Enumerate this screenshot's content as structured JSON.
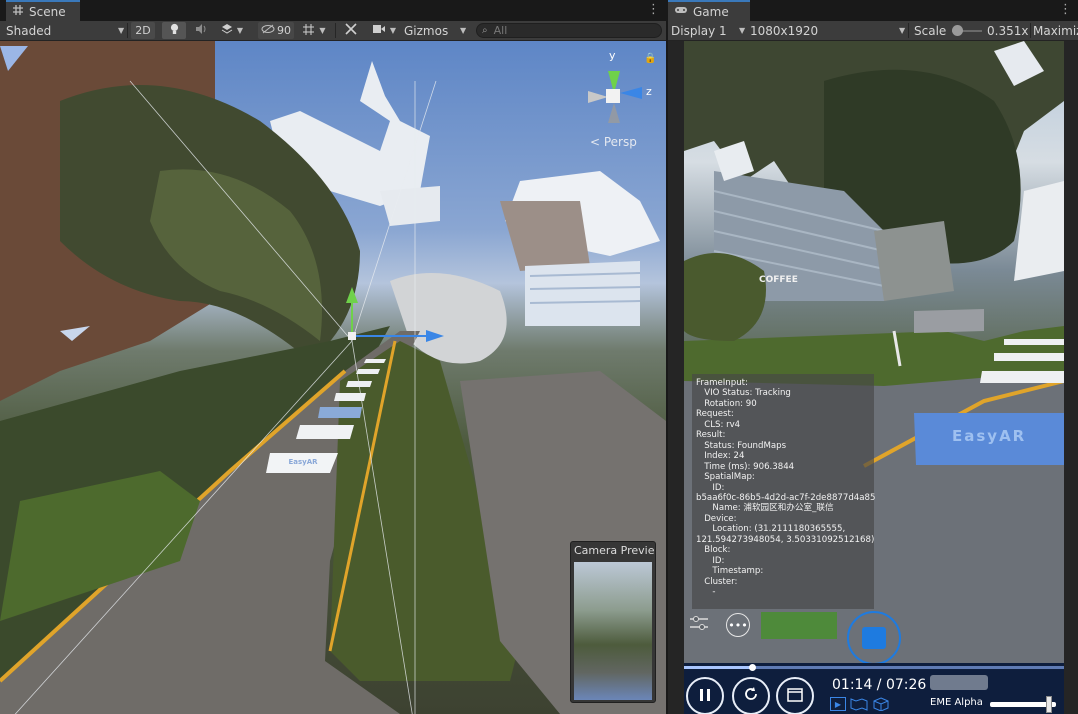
{
  "scene_tab": {
    "title": "Scene",
    "icon": "grid-icon"
  },
  "scene_toolbar": {
    "shading_mode": "Shaded",
    "mode_2d": "2D",
    "hidden_count": "90",
    "gizmos": "Gizmos",
    "search_placeholder": "All"
  },
  "scene_view": {
    "axis_y": "y",
    "axis_z": "z",
    "projection": "< Persp",
    "camera_preview_title": "Camera Preview",
    "crosswalk_text": "EasyAR"
  },
  "game_tab": {
    "title": "Game",
    "icon": "gamepad-icon"
  },
  "game_toolbar": {
    "display": "Display 1",
    "resolution": "1080x1920",
    "scale_label": "Scale",
    "scale_value": "0.351x",
    "maximize": "Maximize"
  },
  "game_view": {
    "sign_text": "COFFEE",
    "crosswalk_text": "EasyAR",
    "debug_lines": [
      "FrameInput:",
      "   VIO Status: Tracking",
      "   Rotation: 90",
      "Request:",
      "   CLS: rv4",
      "Result:",
      "   Status: FoundMaps",
      "   Index: 24",
      "   Time (ms): 906.3844",
      "   SpatialMap:",
      "      ID:",
      "b5aa6f0c-86b5-4d2d-ac7f-2de8877d4a85",
      "      Name: 浦软园区和办公室_联信",
      "   Device:",
      "      Location: (31.2111180365555,",
      "121.594273948054, 3.50331092512168)",
      "   Block:",
      "      ID:",
      "      Timestamp:",
      "   Cluster:",
      "      -"
    ],
    "time": "01:14 / 07:26",
    "progress": 0.18,
    "eme_alpha_label": "EME Alpha",
    "eme_alpha_value": 0.9
  },
  "colors": {
    "accent": "#3a79bb",
    "status_green": "#4e8a3a",
    "capture_blue": "#1e7be0"
  }
}
